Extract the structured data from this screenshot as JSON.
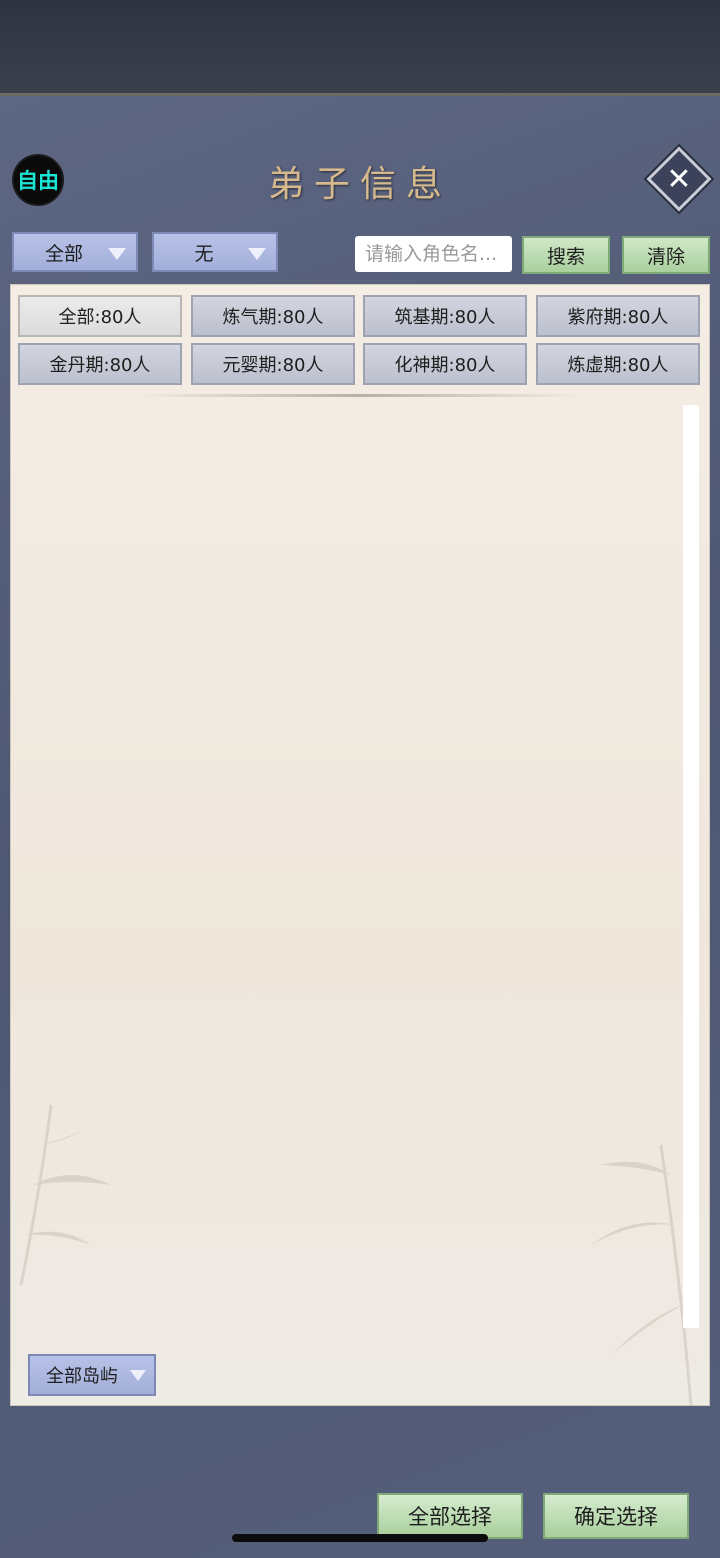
{
  "header": {
    "mode_badge": "自由",
    "title": "弟子信息",
    "close_symbol": "✕"
  },
  "toolbar": {
    "dropdown_1": "全部",
    "dropdown_2": "无",
    "search_placeholder": "请输入角色名...",
    "search_label": "搜索",
    "clear_label": "清除"
  },
  "filters": [
    {
      "label": "全部:80人",
      "active": true
    },
    {
      "label": "炼气期:80人",
      "active": false
    },
    {
      "label": "筑基期:80人",
      "active": false
    },
    {
      "label": "紫府期:80人",
      "active": false
    },
    {
      "label": "金丹期:80人",
      "active": false
    },
    {
      "label": "元婴期:80人",
      "active": false
    },
    {
      "label": "化神期:80人",
      "active": false
    },
    {
      "label": "炼虚期:80人",
      "active": false
    }
  ],
  "island_dropdown": "全部岛屿",
  "footer": {
    "select_all_label": "全部选择",
    "confirm_label": "确定选择"
  },
  "colors": {
    "panel_bg": "#5d6682",
    "title_gold": "#d6b98d",
    "badge_text": "#1ae6d6",
    "green_button": "#a9d09e",
    "blue_dropdown": "#a3afd9"
  }
}
